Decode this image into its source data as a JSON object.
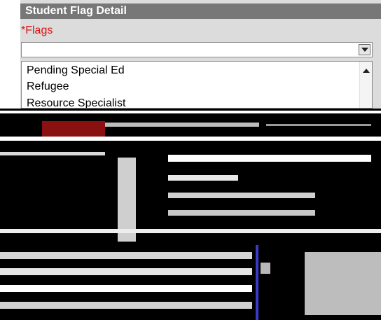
{
  "header": {
    "title": "Student Flag Detail"
  },
  "flags": {
    "label": "*Flags",
    "selected_value": "",
    "options": [
      "Pending Special Ed",
      "Refugee",
      "Resource Specialist"
    ]
  },
  "colors": {
    "header_bg": "#777777",
    "required_label": "#e01010",
    "panel_bg": "#dcdcdc"
  }
}
